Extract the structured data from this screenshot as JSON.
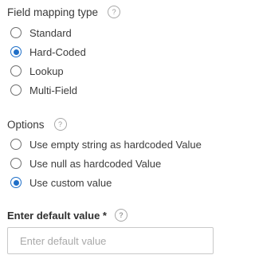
{
  "mapping": {
    "title": "Field mapping type",
    "help": "?",
    "options": [
      {
        "label": "Standard",
        "checked": false
      },
      {
        "label": "Hard-Coded",
        "checked": true
      },
      {
        "label": "Lookup",
        "checked": false
      },
      {
        "label": "Multi-Field",
        "checked": false
      }
    ]
  },
  "options": {
    "title": "Options",
    "help": "?",
    "items": [
      {
        "label": "Use empty string as hardcoded Value",
        "checked": false
      },
      {
        "label": "Use null as hardcoded Value",
        "checked": false
      },
      {
        "label": "Use custom value",
        "checked": true
      }
    ]
  },
  "default_value": {
    "label": "Enter default value *",
    "help": "?",
    "value": "",
    "placeholder": "Enter default value"
  },
  "colors": {
    "accent": "#1f6fc8",
    "text": "#3c3c3c",
    "border": "#c9c9c9"
  }
}
